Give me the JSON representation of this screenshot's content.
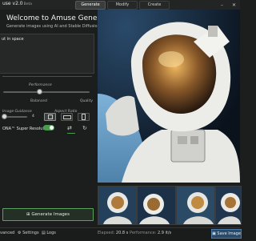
{
  "app": {
    "title": "use v2.0",
    "version": "Beta"
  },
  "tabs": [
    {
      "label": "Generate",
      "active": true
    },
    {
      "label": "Modify",
      "active": false
    },
    {
      "label": "Create",
      "active": false
    }
  ],
  "window_controls": {
    "minimize": "–",
    "close": "✕"
  },
  "welcome": {
    "title": "Welcome to Amuse Generate!",
    "subtitle": "Generate images using AI and Stable Diffusion"
  },
  "prompt": {
    "value": "ut in space"
  },
  "performance": {
    "label": "Performance",
    "min_label": "Balanced",
    "max_label": "Quality"
  },
  "image_guidance": {
    "label": "Image Guidance",
    "value": "4"
  },
  "aspect_ratio": {
    "label": "Aspect Ratio"
  },
  "super_resolution": {
    "label": "ONA™ Super Resolution",
    "enabled": true
  },
  "generate_button": {
    "label": "Generate Images"
  },
  "statusbar": {
    "advanced": "vanced",
    "settings": "Settings",
    "logs": "Logs",
    "elapsed_label": "Elapsed:",
    "elapsed_value": "20.8 s",
    "performance_label": "Performance:",
    "performance_value": "2.9 it/s",
    "save_label": "Save Image"
  },
  "colors": {
    "accent_green": "#4a9d4e",
    "save_blue": "#2a4a6a"
  }
}
